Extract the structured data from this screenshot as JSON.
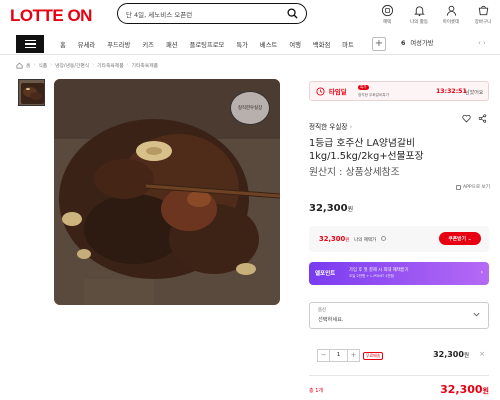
{
  "header": {
    "logo": "LOTTE ON",
    "search_value": "단 4일, 세노비스 오픈런",
    "icons": [
      {
        "name": "coupon",
        "label": "혜택"
      },
      {
        "name": "alert",
        "label": "나의 활동"
      },
      {
        "name": "user",
        "label": "마이롯데"
      },
      {
        "name": "cart",
        "label": "장바구니"
      }
    ]
  },
  "nav": {
    "categories": [
      "홈",
      "뷰세라",
      "푸드라방",
      "키즈",
      "패션",
      "플로팅프로모",
      "특가",
      "베스트",
      "여행",
      "백화점",
      "마트"
    ],
    "rank_number": "6",
    "rank_text": "여성가방",
    "arrows": "‹ ›"
  },
  "breadcrumb": [
    "홈",
    "식품",
    "냉장/냉동/간편식",
    "기타축육제품",
    "기타축육제품"
  ],
  "image_badge": "정직한우실장",
  "timedeal": {
    "label": "타임딜",
    "badge": "특가",
    "sub": "정직한 우화갈비특가",
    "time": "13:32:51",
    "suffix": "남았어요"
  },
  "product": {
    "seller": "정직한 우실장",
    "seller_arrow": "›",
    "title": "1등급 호주산 LA양념갈비 1kg/1.5kg/2kg+선물포장",
    "origin": "원산지 : 상품상세참조",
    "app_view": "APP으로 보기",
    "price": "32,300",
    "price_unit": "원"
  },
  "benefit": {
    "price": "32,300",
    "unit": "원",
    "label": "나의 혜택가",
    "coupon_label": "쿠폰받기 ⌄"
  },
  "promo": {
    "logo": "엘포인트",
    "text": "가입 후 첫 결제 시 최대 혜택받기",
    "sub": "오늘 2만원 + L.POINT 1천점",
    "arrow": "›"
  },
  "option": {
    "label": "옵션",
    "value": "선택하세요."
  },
  "quantity": {
    "minus": "−",
    "value": "1",
    "plus": "+",
    "price_type": "무료배송",
    "price": "32,300",
    "unit": "원",
    "close": "×"
  },
  "total": {
    "label": "총 1개",
    "price": "32,300",
    "unit": "원"
  },
  "colors": {
    "brand_red": "#e60012",
    "promo_purple": "#7a3cf0"
  }
}
